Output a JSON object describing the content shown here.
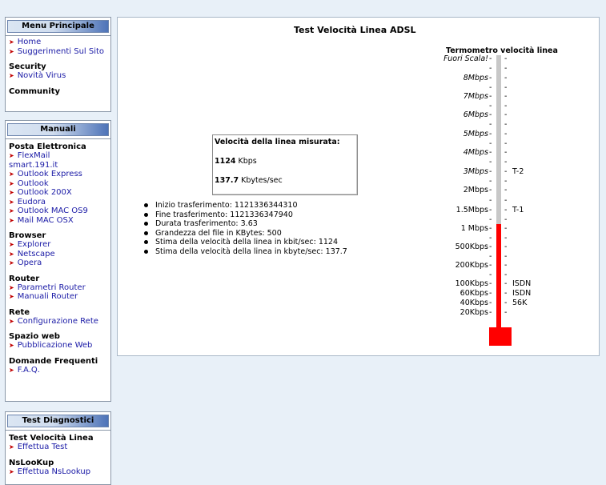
{
  "sidebar": {
    "menu": {
      "title": "Menu Principale",
      "links": [
        "Home",
        "Suggerimenti Sul Sito"
      ],
      "sections": [
        {
          "title": "Security",
          "links": [
            "Novità Virus"
          ]
        },
        {
          "title": "Community",
          "links": []
        }
      ]
    },
    "manuali": {
      "title": "Manuali",
      "sections": [
        {
          "title": "Posta Elettronica",
          "links": [
            "FlexMail smart.191.it",
            "Outlook Express",
            "Outlook",
            "Outlook 200X",
            "Eudora",
            "Outlook MAC OS9",
            "Mail MAC OSX"
          ]
        },
        {
          "title": "Browser",
          "links": [
            "Explorer",
            "Netscape",
            "Opera"
          ]
        },
        {
          "title": "Router",
          "links": [
            "Parametri Router",
            "Manuali Router"
          ]
        },
        {
          "title": "Rete",
          "links": [
            "Configurazione Rete"
          ]
        },
        {
          "title": "Spazio web",
          "links": [
            "Pubblicazione Web"
          ]
        },
        {
          "title": "Domande Frequenti",
          "links": [
            "F.A.Q."
          ]
        }
      ]
    },
    "diagnostici": {
      "title": "Test Diagnostici",
      "sections": [
        {
          "title": "Test Velocità Linea",
          "links": [
            "Effettua Test"
          ]
        },
        {
          "title": "NsLooKup",
          "links": [
            "Effettua NsLookup"
          ]
        }
      ]
    }
  },
  "main": {
    "title": "Test Velocità Linea ADSL",
    "result": {
      "title": "Velocità della linea misurata:",
      "kbps_value": "1124",
      "kbps_unit": "Kbps",
      "kbytes_value": "137.7",
      "kbytes_unit": "Kbytes/sec"
    },
    "stats": [
      "Inizio trasferimento: 1121336344310",
      "Fine trasferimento: 1121336347940",
      "Durata trasferimento: 3.63",
      "Grandezza del file in KBytes: 500",
      "Stima della velocità della linea in kbit/sec: 1124",
      "Stima della velocità della linea in kbyte/sec: 137.7"
    ]
  },
  "thermometer": {
    "title": "Termometro velocità linea",
    "level_kbps": 1124,
    "fill_color": "#ff0000",
    "empty_color": "#c8c8c8",
    "ticks": [
      {
        "label": "Fuori Scala!",
        "italic": true
      },
      {
        "label": "8Mbps",
        "italic": true
      },
      {
        "label": "7Mbps",
        "italic": true
      },
      {
        "label": "6Mbps",
        "italic": true
      },
      {
        "label": "5Mbps",
        "italic": true
      },
      {
        "label": "4Mbps",
        "italic": true
      },
      {
        "label": "3Mbps",
        "italic": true,
        "side": "T-2"
      },
      {
        "label": "2Mbps",
        "italic": false
      },
      {
        "label": "1.5Mbps",
        "italic": false,
        "side": "T-1"
      },
      {
        "label": "1 Mbps",
        "italic": false
      },
      {
        "label": "500Kbps",
        "italic": false
      },
      {
        "label": "200Kbps",
        "italic": false
      },
      {
        "label": "100Kbps",
        "italic": false,
        "side": "ISDN"
      },
      {
        "label": "60Kbps",
        "italic": false,
        "side": "ISDN"
      },
      {
        "label": "40Kbps",
        "italic": false,
        "side": "56K"
      },
      {
        "label": "20Kbps",
        "italic": false
      }
    ]
  }
}
